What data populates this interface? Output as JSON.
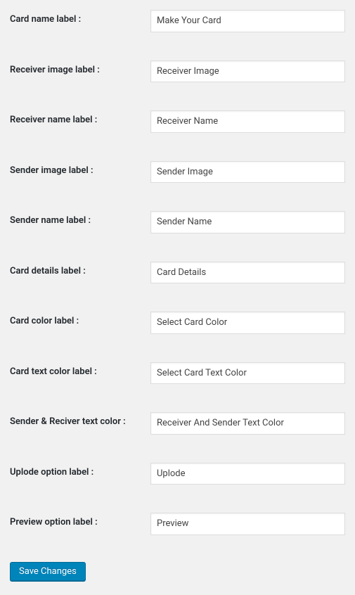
{
  "fields": [
    {
      "label": "Card name label :",
      "value": "Make Your Card",
      "name": "card-name-label"
    },
    {
      "label": "Receiver image label :",
      "value": "Receiver Image",
      "name": "receiver-image-label"
    },
    {
      "label": "Receiver name label :",
      "value": "Receiver Name",
      "name": "receiver-name-label"
    },
    {
      "label": "Sender image label :",
      "value": "Sender Image",
      "name": "sender-image-label"
    },
    {
      "label": "Sender name label :",
      "value": "Sender Name",
      "name": "sender-name-label"
    },
    {
      "label": "Card details label :",
      "value": "Card Details",
      "name": "card-details-label"
    },
    {
      "label": "Card color label :",
      "value": "Select Card Color",
      "name": "card-color-label"
    },
    {
      "label": "Card text color label :",
      "value": "Select Card Text Color",
      "name": "card-text-color-label"
    },
    {
      "label": "Sender & Reciver text color :",
      "value": "Receiver And Sender Text Color",
      "name": "sender-receiver-text-color"
    },
    {
      "label": "Uplode option label :",
      "value": "Uplode",
      "name": "upload-option-label"
    },
    {
      "label": "Preview option label :",
      "value": "Preview",
      "name": "preview-option-label"
    }
  ],
  "submit": {
    "label": "Save Changes"
  }
}
